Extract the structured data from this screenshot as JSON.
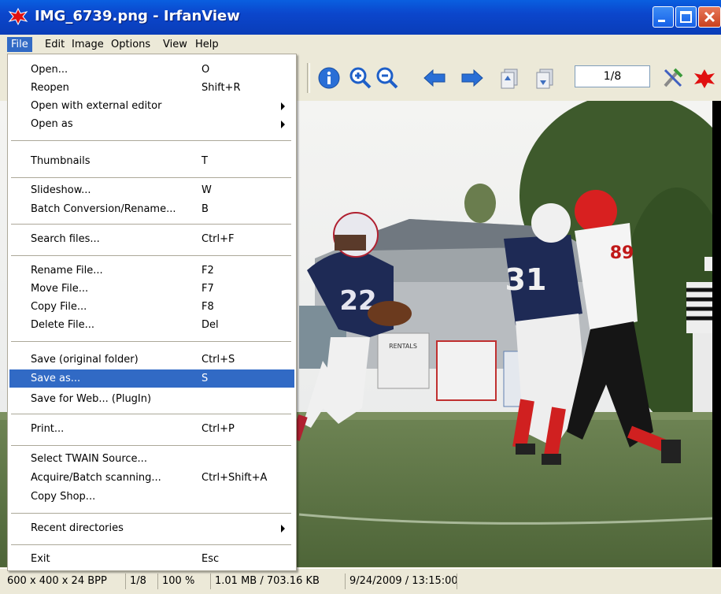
{
  "window": {
    "title": "IMG_6739.png - IrfanView"
  },
  "menubar": {
    "items": [
      "File",
      "Edit",
      "Image",
      "Options",
      "View",
      "Help"
    ]
  },
  "toolbar": {
    "page_counter": "1/8"
  },
  "file_menu": {
    "items": [
      {
        "label": "Open...",
        "shortcut": "O"
      },
      {
        "label": "Reopen",
        "shortcut": "Shift+R"
      },
      {
        "label": "Open with external editor",
        "shortcut": ""
      },
      {
        "label": "Open as",
        "shortcut": ""
      },
      {
        "label": "Thumbnails",
        "shortcut": "T"
      },
      {
        "label": "Slideshow...",
        "shortcut": "W"
      },
      {
        "label": "Batch Conversion/Rename...",
        "shortcut": "B"
      },
      {
        "label": "Search files...",
        "shortcut": "Ctrl+F"
      },
      {
        "label": "Rename File...",
        "shortcut": "F2"
      },
      {
        "label": "Move File...",
        "shortcut": "F7"
      },
      {
        "label": "Copy File...",
        "shortcut": "F8"
      },
      {
        "label": "Delete File...",
        "shortcut": "Del"
      },
      {
        "label": "Save (original folder)",
        "shortcut": "Ctrl+S"
      },
      {
        "label": "Save as...",
        "shortcut": "S"
      },
      {
        "label": "Save for Web... (PlugIn)",
        "shortcut": ""
      },
      {
        "label": "Print...",
        "shortcut": "Ctrl+P"
      },
      {
        "label": "Select TWAIN Source...",
        "shortcut": ""
      },
      {
        "label": "Acquire/Batch scanning...",
        "shortcut": "Ctrl+Shift+A"
      },
      {
        "label": "Copy Shop...",
        "shortcut": ""
      },
      {
        "label": "Recent directories",
        "shortcut": ""
      },
      {
        "label": "Exit",
        "shortcut": "Esc"
      }
    ]
  },
  "statusbar": {
    "dimensions": "600 x 400 x 24 BPP",
    "index": "1/8",
    "zoom": "100 %",
    "size": "1.01 MB / 703.16 KB",
    "datetime": "9/24/2009 / 13:15:00"
  },
  "photo": {
    "jersey_numbers": [
      "22",
      "31",
      "89"
    ],
    "sign_texts": [
      "RENTALS"
    ]
  },
  "colors": {
    "selection": "#316AC5",
    "titlebar": "#0B46CC",
    "chrome": "#ECE9D8"
  }
}
